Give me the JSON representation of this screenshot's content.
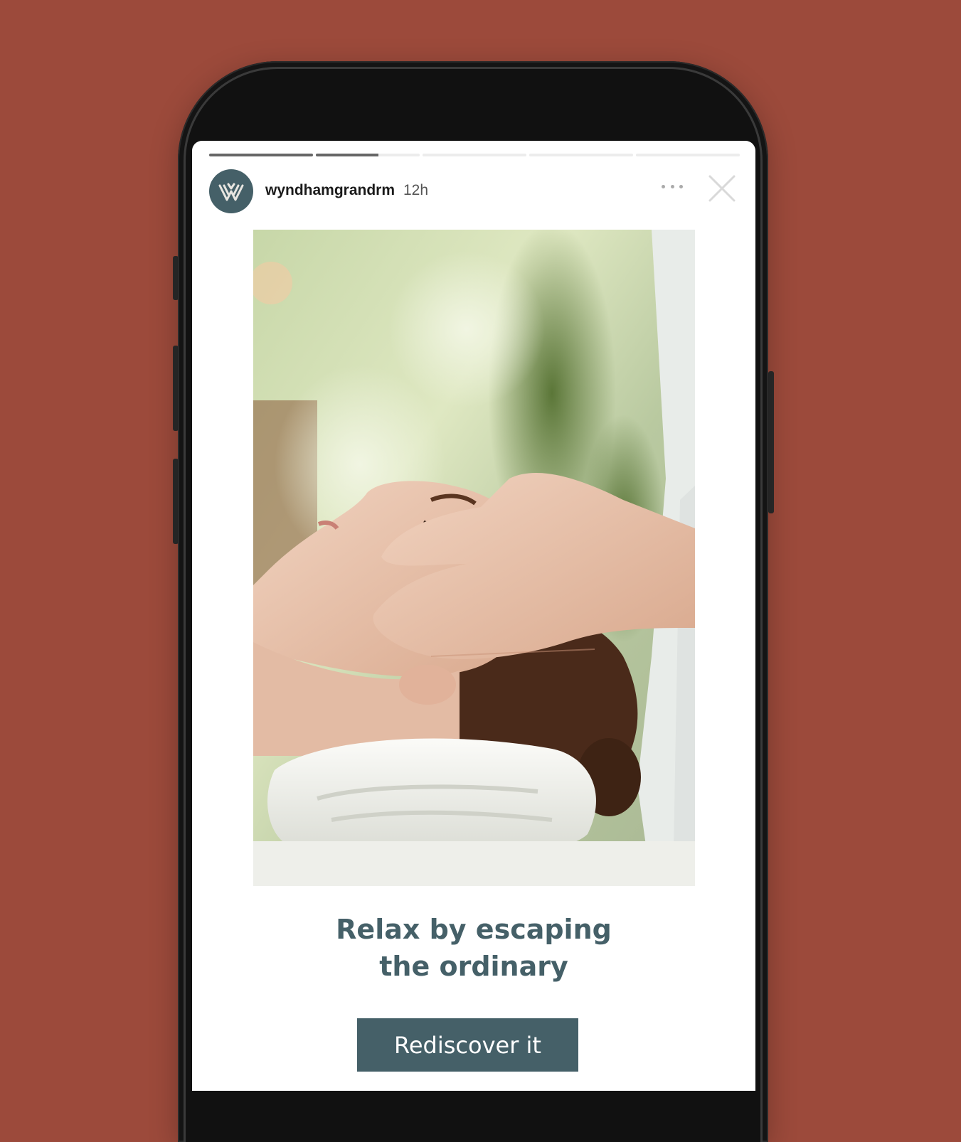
{
  "story": {
    "username": "wyndhamgrandrm",
    "time_ago": "12h",
    "progress": [
      1,
      0.6,
      0,
      0,
      0
    ],
    "headline_line1": "Relax by escaping",
    "headline_line2": "the ordinary",
    "cta_label": "Rediscover it"
  },
  "icons": {
    "avatar": "wyndham-logo-icon",
    "more": "more-dots-icon",
    "close": "close-icon"
  },
  "colors": {
    "background": "#9c4a3b",
    "brand": "#456068",
    "progress_active": "#666666",
    "progress_inactive": "#ececec"
  }
}
